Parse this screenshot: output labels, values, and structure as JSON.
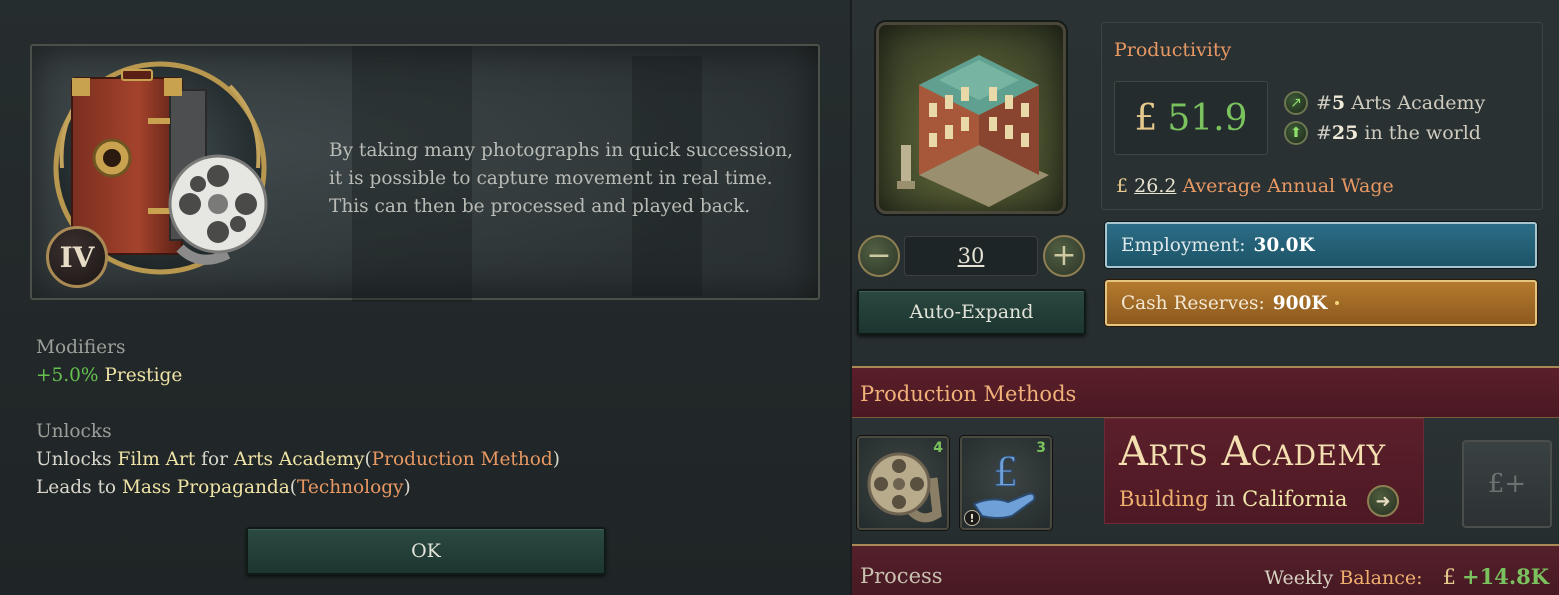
{
  "tech_popup": {
    "tier": "IV",
    "description": "By taking many photographs in quick succession, it is possible to capture movement in real time. This can then be processed and played back.",
    "modifiers_heading": "Modifiers",
    "modifier": {
      "value": "+5.0%",
      "label": "Prestige"
    },
    "unlocks_heading": "Unlocks",
    "unlock_line_1": {
      "prefix": "Unlocks",
      "item": "Film Art",
      "for": "for",
      "target": "Arts Academy",
      "open": "(",
      "type": "Production Method",
      "close": ")"
    },
    "unlock_line_2": {
      "prefix": "Leads to",
      "item": "Mass Propaganda",
      "open": "(",
      "type": "Technology",
      "close": ")"
    },
    "ok_label": "OK"
  },
  "building": {
    "level": "30",
    "minus_label": "−",
    "plus_label": "+",
    "auto_expand_label": "Auto-Expand",
    "productivity": {
      "title": "Productivity",
      "currency": "£",
      "value": "51.9",
      "rank_state_prefix": "#",
      "rank_state_num": "5",
      "rank_state_label": "Arts Academy",
      "rank_world_prefix": "#",
      "rank_world_num": "25",
      "rank_world_label": "in the world",
      "wage_value": "26.2",
      "wage_label": "Average Annual Wage"
    },
    "employment_label": "Employment:",
    "employment_value": "30.0K",
    "cash_label": "Cash Reserves:",
    "cash_value": "900K",
    "production_methods_title": "Production Methods",
    "pm_slot_1_count": "4",
    "pm_slot_2_count": "3",
    "pm_slot_2_warning": "!",
    "name": "Arts Academy",
    "sub_building": "Building",
    "sub_in": "in",
    "sub_state": "California",
    "add_money_label": "£+",
    "process_label": "Process",
    "weekly_label": "Weekly",
    "balance_label": "Balance:",
    "balance_currency": "£",
    "balance_value": "+14.8K"
  },
  "colors": {
    "accent_gold": "#a98a55",
    "positive_green": "#7ac25e",
    "highlight_orange": "#e89863",
    "employment_blue": "#2c6d86",
    "cash_orange": "#b47a2e",
    "banner_maroon": "#5a1f2a"
  },
  "icons": {
    "camera": "camera-film-icon",
    "film_reel": "film-reel-icon",
    "money_hand": "money-hand-icon",
    "rank_arrow": "rank-up-arrow-icon",
    "goto": "arrow-right-icon"
  }
}
